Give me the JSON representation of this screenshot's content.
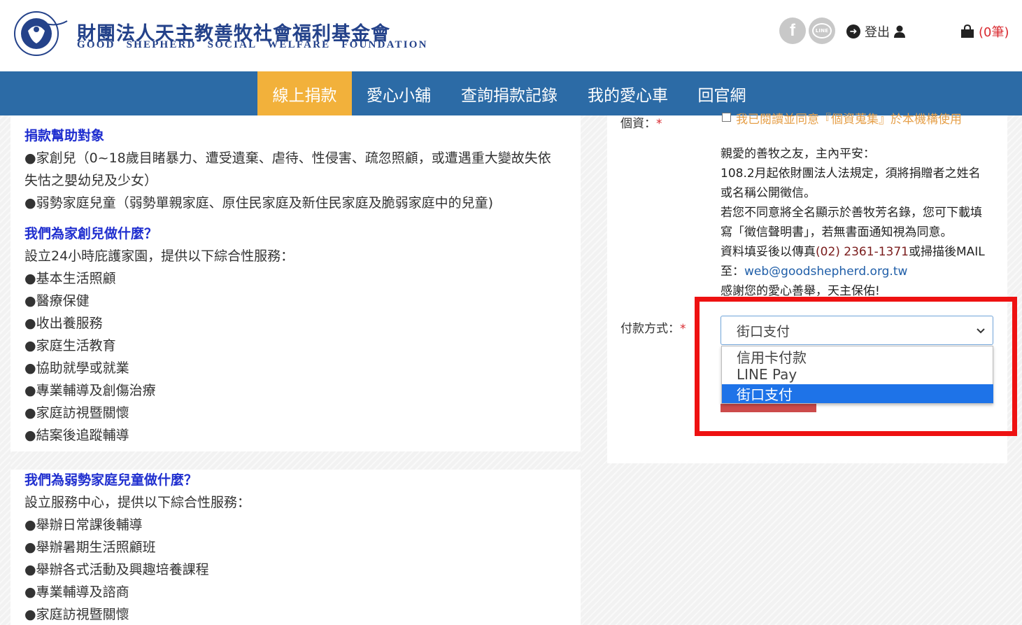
{
  "header": {
    "org_name_zh": "財團法人天主教善牧社會福利基金會",
    "org_name_en": "GOOD SHEPHERD SOCIAL WELFARE FOUNDATION",
    "facebook_glyph": "f",
    "line_glyph": "LINE",
    "logout_label": "登出",
    "cart_count": "(0筆)"
  },
  "nav": {
    "items": [
      {
        "label": "線上捐款",
        "active": true
      },
      {
        "label": "愛心小舖",
        "active": false
      },
      {
        "label": "查詢捐款記錄",
        "active": false
      },
      {
        "label": "我的愛心車",
        "active": false
      },
      {
        "label": "回官網",
        "active": false
      }
    ]
  },
  "left": {
    "sec1_heading": "捐款幫助對象",
    "sec1_item1_a": "●家創兒（0~18歲目睹暴力、遭受遺棄、虐待、性侵害、疏忽照顧，或遭遇重大變故失依",
    "sec1_item1_b": "失怙之嬰幼兒及少女）",
    "sec1_item2": "●弱勢家庭兒童（弱勢單親家庭、原住民家庭及新住民家庭及脆弱家庭中的兒童)",
    "sec2_heading": "我們為家創兒做什麼？",
    "sec2_intro": "設立24小時庇護家園，提供以下綜合性服務：",
    "sec2_items": [
      "●基本生活照顧",
      "●醫療保健",
      "●收出養服務",
      "●家庭生活教育",
      "●協助就學或就業",
      "●專業輔導及創傷治療",
      "●家庭訪視暨關懷",
      "●結案後追蹤輔導"
    ],
    "sec3_heading": "我們為弱勢家庭兒童做什麼？",
    "sec3_intro": "設立服務中心，提供以下綜合性服務：",
    "sec3_items": [
      "●舉辦日常課後輔導",
      "●舉辦暑期生活照顧班",
      "●舉辦各式活動及興趣培養課程",
      "●專業輔導及諮商",
      "●家庭訪視暨關懷"
    ]
  },
  "form": {
    "privacy_label": "個資：",
    "privacy_consent": "我已閱讀並同意『個資蒐集』於本機構使用",
    "notice": {
      "line1": "親愛的善牧之友，主內平安：",
      "line2": "108.2月起依財團法人法規定，須將捐贈者之姓名",
      "line3": "或名稱公開徵信。",
      "line4": "若您不同意將全名顯示於善牧芳名錄，您可下載填",
      "line5": "寫「徵信聲明書」，若無書面通知視為同意。",
      "line6_a": "資料填妥後以傳真",
      "line6_b": "(02) 2361-1371",
      "line6_c": "或掃描後MAIL",
      "line7_a": "至：",
      "line7_b": "web@goodshepherd.org.tw",
      "line8": "感謝您的愛心善舉，天主保佑!"
    },
    "payment_label": "付款方式：",
    "required_mark": "*",
    "payment_selected": "街口支付",
    "payment_options": [
      "信用卡付款",
      "LINE Pay",
      "街口支付"
    ]
  },
  "colors": {
    "nav_bg": "#2c6ba6",
    "nav_active": "#f2b13b",
    "heading_blue": "#1f2ecf",
    "highlight_red": "#ee1111",
    "option_selected": "#1e73e8"
  }
}
